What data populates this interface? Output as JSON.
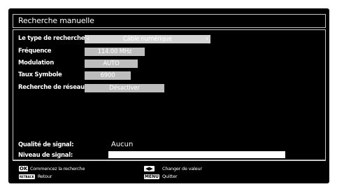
{
  "window": {
    "title": "Recherche manuelle"
  },
  "settings": [
    {
      "label": "Le type de recherche",
      "value": "Câble numérique"
    },
    {
      "label": "Fréquence",
      "value": "114.00 MHz"
    },
    {
      "label": "Modulation",
      "value": "AUTO"
    },
    {
      "label": "Taux Symbole",
      "value": "6900"
    },
    {
      "label": "Recherche de réseau",
      "value": "Désactiver"
    }
  ],
  "signal": {
    "quality_label": "Qualité de signal:",
    "quality_value": "Aucun",
    "level_label": "Niveau de signal:",
    "level_fraction": 0
  },
  "footer": {
    "ok_key": "OK",
    "ok_text": "Commencez la recherche",
    "back_key": "RETBACK",
    "back_text": "Retour",
    "change_text": "Changer de valeur",
    "menu_key": "MENU",
    "menu_text": "Quitter"
  },
  "icons": {
    "left": "left-arrow-icon",
    "right": "right-arrow-icon"
  }
}
